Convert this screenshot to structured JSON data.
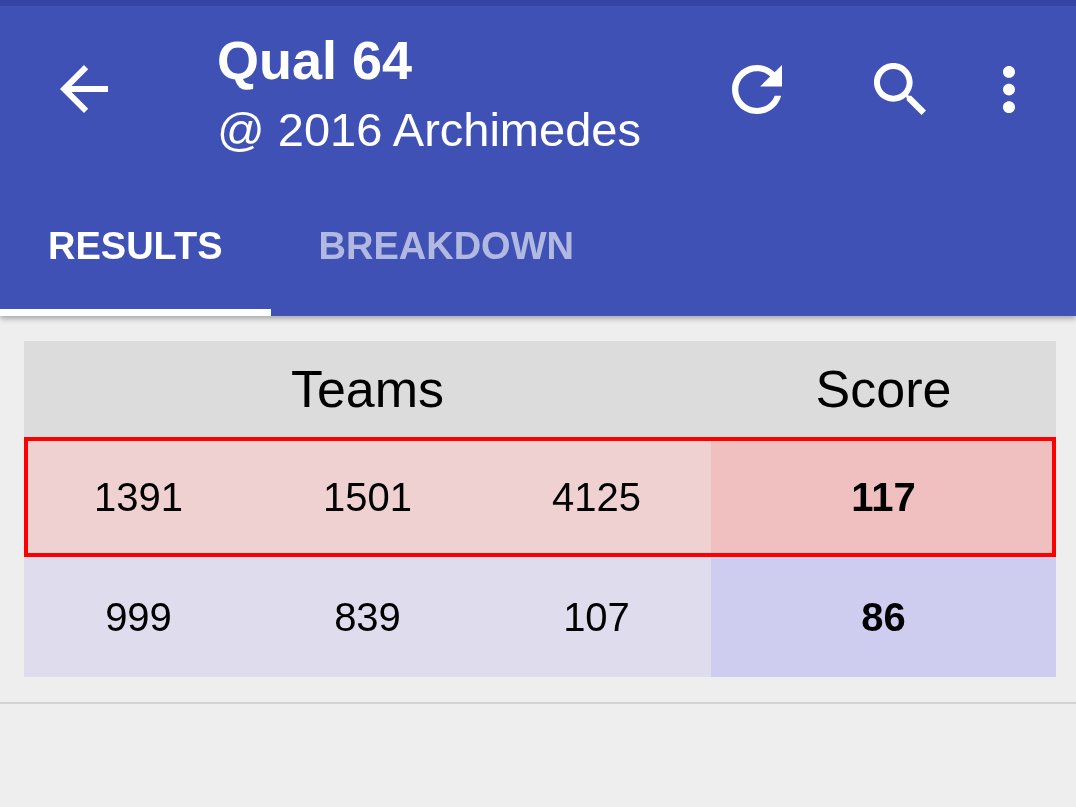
{
  "app_bar": {
    "title": "Qual 64",
    "subtitle": "@ 2016 Archimedes"
  },
  "tabs": [
    {
      "label": "RESULTS",
      "selected": true
    },
    {
      "label": "BREAKDOWN",
      "selected": false
    }
  ],
  "table": {
    "columns": [
      "Teams",
      "Score"
    ],
    "rows": [
      {
        "kind": "red",
        "winner": true,
        "teams": [
          "1391",
          "1501",
          "4125"
        ],
        "score": "117"
      },
      {
        "kind": "blue",
        "winner": false,
        "teams": [
          "999",
          "839",
          "107"
        ],
        "score": "86"
      }
    ]
  }
}
